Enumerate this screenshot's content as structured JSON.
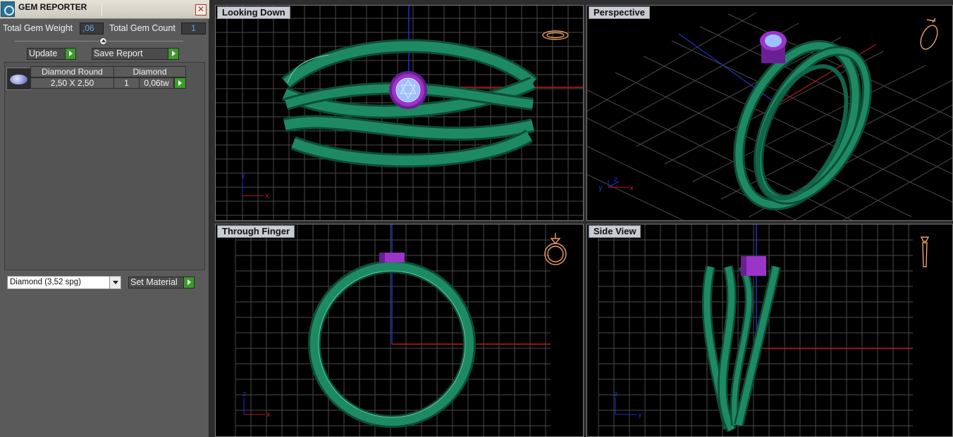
{
  "panel": {
    "title": "GEM REPORTER",
    "close_glyph": "✕",
    "total_weight_label": "Total Gem Weight",
    "total_weight_value": ",06",
    "total_count_label": "Total Gem Count",
    "total_count_value": "1",
    "update_label": "Update",
    "save_report_label": "Save Report",
    "gem_list": [
      {
        "name": "Diamond Round",
        "material": "Diamond",
        "size": "2,50 X 2,50",
        "count": "1",
        "weight": "0,06tw"
      }
    ],
    "material_select": "Diamond     (3,52 spg)",
    "set_material_label": "Set Material"
  },
  "viewports": {
    "top_left": {
      "label": "Looking Down",
      "axes": [
        "y",
        "x"
      ]
    },
    "top_right": {
      "label": "Perspective",
      "axes": [
        "y",
        "z",
        "x"
      ]
    },
    "bottom_left": {
      "label": "Through Finger",
      "axes": [
        "z",
        "x"
      ]
    },
    "bottom_right": {
      "label": "Side View",
      "axes": [
        "z",
        "y"
      ]
    }
  },
  "colors": {
    "ring_green": "#1e8a63",
    "ring_dark": "#0c4d36",
    "gem_setting": "#9b34c9",
    "gem_stone": "#9fc0ff",
    "grid": "#4a4a4a",
    "axis_red": "#c01818",
    "axis_blue": "#2030d0",
    "icon_orange": "#f0a060"
  }
}
